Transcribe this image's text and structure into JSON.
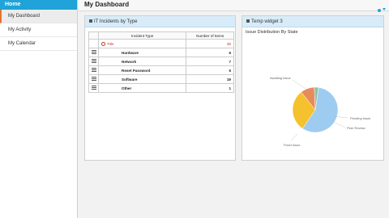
{
  "sidebar": {
    "home_label": "Home",
    "items": [
      {
        "label": "My Dashboard",
        "active": true
      },
      {
        "label": "My Activity",
        "active": false
      },
      {
        "label": "My Calendar",
        "active": false
      }
    ]
  },
  "header": {
    "title": "My Dashboard"
  },
  "widget_incidents": {
    "title": "IT Incidents by Type",
    "columns": [
      "Incident Type",
      "Number of Items"
    ],
    "rows": [
      {
        "type": "Title",
        "count": "38"
      },
      {
        "type": "Hardware",
        "count": "6"
      },
      {
        "type": "Network",
        "count": "7"
      },
      {
        "type": "Reset Password",
        "count": "5"
      },
      {
        "type": "Software",
        "count": "19"
      },
      {
        "type": "Other",
        "count": "1"
      }
    ]
  },
  "widget_pie": {
    "title": "Temp widget 3",
    "subtitle": "Issue Distribution By State",
    "labels": {
      "awaiting": "Awaiting Issue",
      "pending": "Pending Issue",
      "peer_review": "Peer Review",
      "fixed": "Fixed Issue"
    },
    "colors": {
      "awaiting": "#9ecbf0",
      "fixed": "#f5c12d",
      "pending": "#e88b5c",
      "peer_review": "#8fc2a7"
    }
  },
  "chart_data": {
    "type": "pie",
    "categories": [
      "Awaiting Issue",
      "Fixed Issue",
      "Pending Issue",
      "Peer Review"
    ],
    "values": [
      57,
      30,
      10,
      3
    ]
  }
}
